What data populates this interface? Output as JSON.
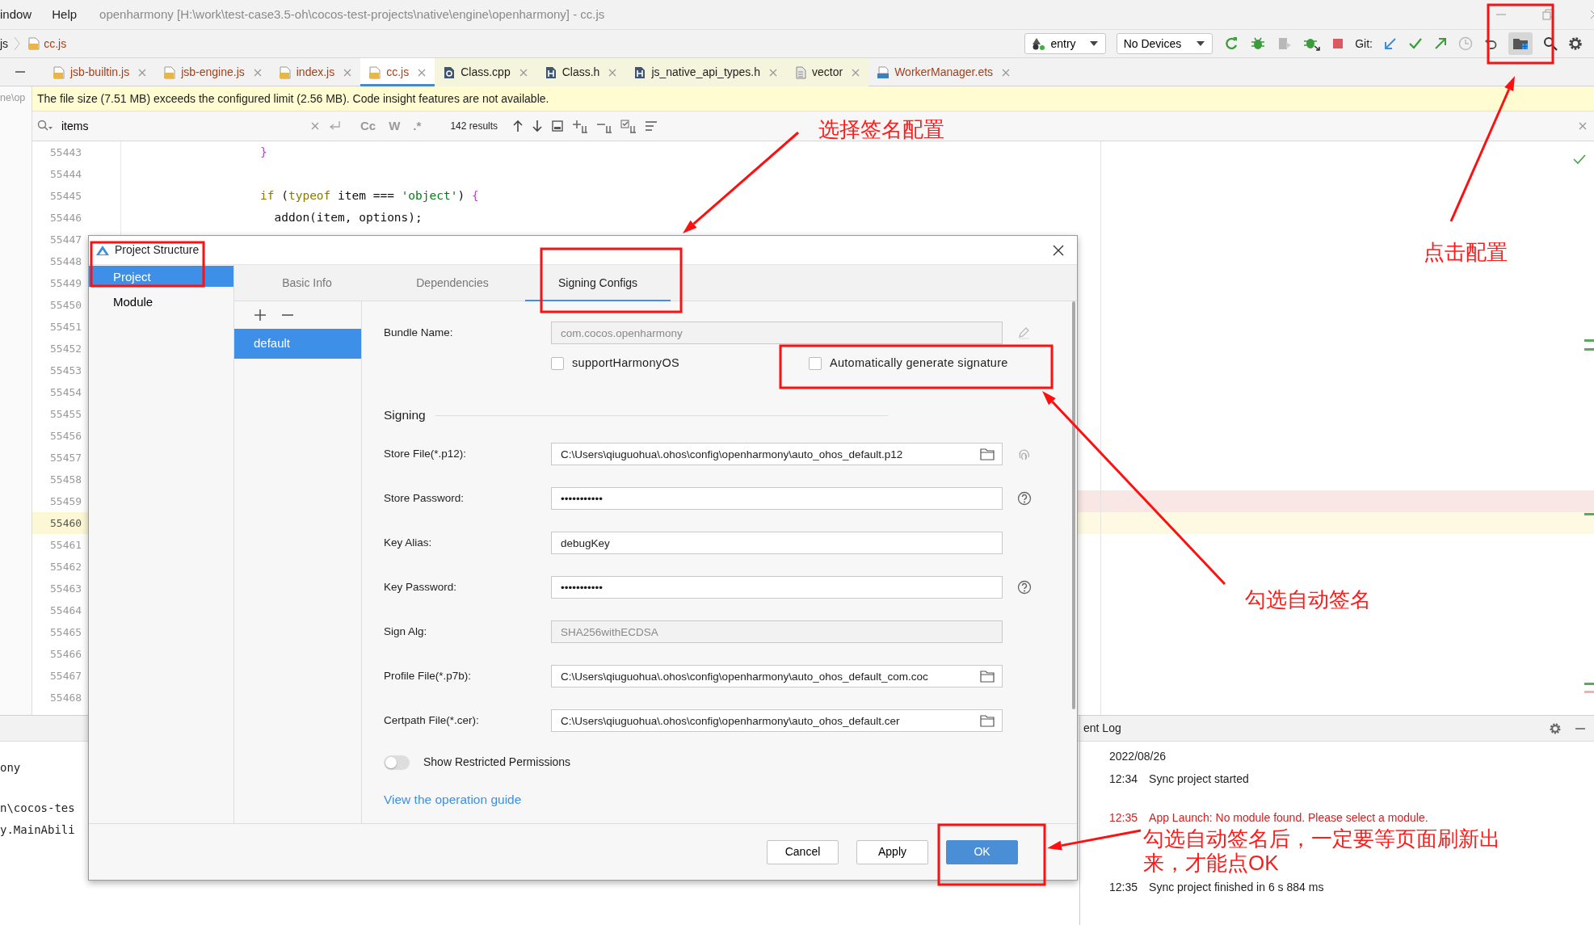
{
  "menu_bar": {
    "items": [
      "indow",
      "Help"
    ],
    "title": "openharmony [H:\\work\\test-case3.5-oh\\cocos-test-projects\\native\\engine\\openharmony] - cc.js"
  },
  "navigation_bar": {
    "breadcrumbs": [
      "js",
      "cc.js"
    ],
    "run_config": "entry",
    "device": "No Devices",
    "git_label": "Git:"
  },
  "editor_tabs": [
    {
      "label": "jsb-builtin.js",
      "kind": "js",
      "external": false,
      "selected": false
    },
    {
      "label": "jsb-engine.js",
      "kind": "js",
      "external": false,
      "selected": false
    },
    {
      "label": "index.js",
      "kind": "js",
      "external": false,
      "selected": false
    },
    {
      "label": "cc.js",
      "kind": "js",
      "external": false,
      "selected": true
    },
    {
      "label": "Class.cpp",
      "kind": "cpp",
      "external": true,
      "selected": false
    },
    {
      "label": "Class.h",
      "kind": "header",
      "external": true,
      "selected": false
    },
    {
      "label": "js_native_api_types.h",
      "kind": "header",
      "external": true,
      "selected": false
    },
    {
      "label": "vector",
      "kind": "plain",
      "external": true,
      "selected": false
    },
    {
      "label": "WorkerManager.ets",
      "kind": "ets",
      "external": false,
      "selected": false
    }
  ],
  "project_path_fragment": "ne\\op",
  "notice": "The file size (7.51 MB) exceeds the configured limit (2.56 MB). Code insight features are not available.",
  "find_bar": {
    "query": "items",
    "case_label": "Cc",
    "word_label": "W",
    "regex_label": ".*",
    "results": "142 results"
  },
  "editor": {
    "lines": [
      {
        "number": "55443",
        "current": false,
        "flagged": false,
        "tokens": [
          {
            "text": "}",
            "kind": "brace"
          }
        ]
      },
      {
        "number": "55444",
        "current": false,
        "flagged": false
      },
      {
        "number": "55445",
        "current": false,
        "flagged": false,
        "tokens": [
          {
            "text": "if",
            "kind": "keyword"
          },
          {
            "text": " (",
            "kind": "plain"
          },
          {
            "text": "typeof",
            "kind": "keyword"
          },
          {
            "text": " item === ",
            "kind": "plain"
          },
          {
            "text": "'object'",
            "kind": "string"
          },
          {
            "text": ") ",
            "kind": "plain"
          },
          {
            "text": "{",
            "kind": "brace"
          }
        ]
      },
      {
        "number": "55446",
        "current": false,
        "flagged": false,
        "tokens": [
          {
            "text": "  addon(item, options);",
            "kind": "plain"
          }
        ]
      },
      {
        "number": "55447",
        "current": false,
        "flagged": false
      },
      {
        "number": "55448",
        "current": false,
        "flagged": false
      },
      {
        "number": "55449",
        "current": false,
        "flagged": false
      },
      {
        "number": "55450",
        "current": false,
        "flagged": false
      },
      {
        "number": "55451",
        "current": false,
        "flagged": false
      },
      {
        "number": "55452",
        "current": false,
        "flagged": false
      },
      {
        "number": "55453",
        "current": false,
        "flagged": false
      },
      {
        "number": "55454",
        "current": false,
        "flagged": false
      },
      {
        "number": "55455",
        "current": false,
        "flagged": false
      },
      {
        "number": "55456",
        "current": false,
        "flagged": false
      },
      {
        "number": "55457",
        "current": false,
        "flagged": false
      },
      {
        "number": "55458",
        "current": false,
        "flagged": false
      },
      {
        "number": "55459",
        "current": false,
        "flagged": true
      },
      {
        "number": "55460",
        "current": true,
        "flagged": false
      },
      {
        "number": "55461",
        "current": false,
        "flagged": false
      },
      {
        "number": "55462",
        "current": false,
        "flagged": false
      },
      {
        "number": "55463",
        "current": false,
        "flagged": false
      },
      {
        "number": "55464",
        "current": false,
        "flagged": false
      },
      {
        "number": "55465",
        "current": false,
        "flagged": false
      },
      {
        "number": "55466",
        "current": false,
        "flagged": false
      },
      {
        "number": "55467",
        "current": false,
        "flagged": false
      },
      {
        "number": "55468",
        "current": false,
        "flagged": false
      }
    ]
  },
  "run_output": [
    "ony",
    "n\\cocos-tes",
    "y.MainAbili"
  ],
  "event_log": {
    "title": "ent Log",
    "date": "2022/08/26",
    "entries": [
      {
        "time": "12:34",
        "message": "Sync project started",
        "error": false
      },
      {
        "time": "12:35",
        "message": "App Launch: No module found. Please select a module.",
        "error": true
      },
      {
        "time": "12:35",
        "message": "Sync project finished in 6 s 884 ms",
        "error": false
      }
    ]
  },
  "dialog": {
    "title": "Project Structure",
    "sidebar": [
      {
        "label": "Project",
        "selected": true
      },
      {
        "label": "Module",
        "selected": false
      }
    ],
    "tabs": [
      {
        "label": "Basic Info",
        "selected": false
      },
      {
        "label": "Dependencies",
        "selected": false
      },
      {
        "label": "Signing Configs",
        "selected": true
      }
    ],
    "configs": [
      {
        "label": "default",
        "selected": true
      }
    ],
    "fields_top": [
      {
        "label": "Bundle Name:",
        "value": "com.cocos.openharmony",
        "disabled": true,
        "kind": "editable"
      }
    ],
    "checkboxes": [
      {
        "label": "supportHarmonyOS",
        "checked": false
      },
      {
        "label": "Automatically generate signature",
        "checked": false
      }
    ],
    "section": "Signing",
    "fields": [
      {
        "label": "Store File(*.p12):",
        "value": "C:\\Users\\qiuguohua\\.ohos\\config\\openharmony\\auto_ohos_default.p12",
        "disabled": false,
        "kind": "keystore"
      },
      {
        "label": "Store Password:",
        "value": "•••••••••••",
        "disabled": false,
        "kind": "secret"
      },
      {
        "label": "Key Alias:",
        "value": "debugKey",
        "disabled": false,
        "kind": "plain"
      },
      {
        "label": "Key Password:",
        "value": "•••••••••••",
        "disabled": false,
        "kind": "secret"
      },
      {
        "label": "Sign Alg:",
        "value": "SHA256withECDSA",
        "disabled": true,
        "kind": "plain"
      },
      {
        "label": "Profile File(*.p7b):",
        "value": "C:\\Users\\qiuguohua\\.ohos\\config\\openharmony\\auto_ohos_default_com.coc",
        "disabled": false,
        "kind": "file"
      },
      {
        "label": "Certpath File(*.cer):",
        "value": "C:\\Users\\qiuguohua\\.ohos\\config\\openharmony\\auto_ohos_default.cer",
        "disabled": false,
        "kind": "file"
      }
    ],
    "toggle": {
      "label": "Show Restricted Permissions",
      "on": false
    },
    "link": "View the operation guide",
    "buttons": [
      {
        "label": "Cancel",
        "primary": false
      },
      {
        "label": "Apply",
        "primary": false
      },
      {
        "label": "OK",
        "primary": true
      }
    ]
  },
  "annotations": [
    {
      "text": "选择签名配置"
    },
    {
      "text": "点击配置"
    },
    {
      "text": "勾选自动签名"
    },
    {
      "text": "勾选自动签名后，一定要等页面刷新出来，才能点OK"
    }
  ]
}
